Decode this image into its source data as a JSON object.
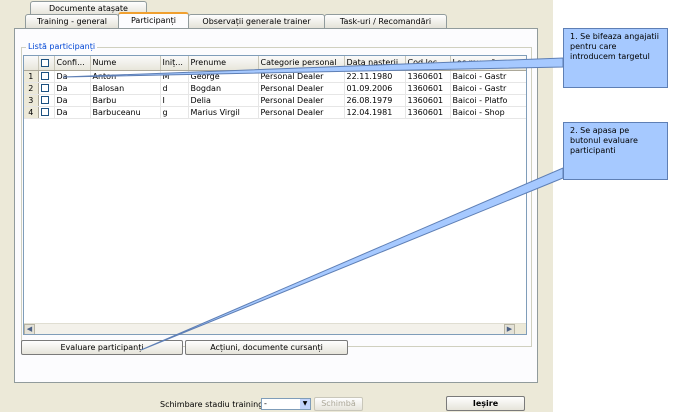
{
  "tabs_row1": [
    {
      "label": "Documente atașate"
    }
  ],
  "tabs_row2": [
    {
      "label": "Training - general"
    },
    {
      "label": "Participanți",
      "active": true
    },
    {
      "label": "Observații generale trainer"
    },
    {
      "label": "Task-uri / Recomandări"
    }
  ],
  "group_label": "Listă participanți",
  "grid": {
    "columns": [
      "",
      "Confi...",
      "Nume",
      "Iniț...",
      "Prenume",
      "Categorie personal",
      "Data nașterii",
      "Cod loc...",
      "Loc muncă"
    ],
    "rows": [
      {
        "n": "1",
        "conf": "Da",
        "nume": "Anton",
        "init": "M",
        "prenume": "George",
        "cat": "Personal Dealer",
        "data": "22.11.1980",
        "cod": "1360601",
        "loc": "Baicoi - Gastr"
      },
      {
        "n": "2",
        "conf": "Da",
        "nume": "Balosan",
        "init": "d",
        "prenume": "Bogdan",
        "cat": "Personal Dealer",
        "data": "01.09.2006",
        "cod": "1360601",
        "loc": "Baicoi - Gastr"
      },
      {
        "n": "3",
        "conf": "Da",
        "nume": "Barbu",
        "init": "I",
        "prenume": "Delia",
        "cat": "Personal Dealer",
        "data": "26.08.1979",
        "cod": "1360601",
        "loc": "Baicoi - Platfo"
      },
      {
        "n": "4",
        "conf": "Da",
        "nume": "Barbuceanu",
        "init": "g",
        "prenume": "Marius Virgil",
        "cat": "Personal Dealer",
        "data": "12.04.1981",
        "cod": "1360601",
        "loc": "Baicoi - Shop"
      }
    ]
  },
  "buttons": {
    "evaluare": "Evaluare participanți",
    "actiuni": "Acțiuni, documente cursanți",
    "schimba": "Schimbă",
    "iesire": "Ieșire"
  },
  "status": {
    "label": "Schimbare stadiu training:",
    "value": "-"
  },
  "callouts": {
    "c1": "1. Se bifeaza angajatii pentru care introducem targetul",
    "c2": "2. Se apasa pe butonul evaluare participanti"
  },
  "colors": {
    "callout_fill": "#a6c9ff",
    "window_bg": "#ece9d8",
    "active_tab_accent": "#f0a030"
  }
}
